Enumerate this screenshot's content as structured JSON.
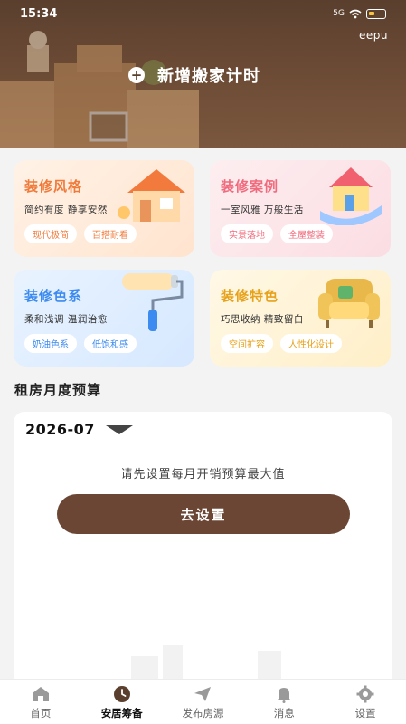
{
  "status_bar": {
    "time": "15:34",
    "network": "5G",
    "battery": "11"
  },
  "header": {
    "brand": "eepu",
    "add_timer_label": "新增搬家计时"
  },
  "cards": [
    {
      "title": "装修风格",
      "subtitle": "简约有度 静享安然",
      "tags": [
        "现代极简",
        "百搭耐看"
      ]
    },
    {
      "title": "装修案例",
      "subtitle": "一室风雅 万般生活",
      "tags": [
        "实景落地",
        "全屋整装"
      ]
    },
    {
      "title": "装修色系",
      "subtitle": "柔和浅调 温润治愈",
      "tags": [
        "奶油色系",
        "低饱和感"
      ]
    },
    {
      "title": "装修特色",
      "subtitle": "巧思收纳 精致留白",
      "tags": [
        "空间扩容",
        "人性化设计"
      ]
    }
  ],
  "budget": {
    "section_title": "租房月度预算",
    "month": "2026-07",
    "hint": "请先设置每月开销预算最大值",
    "button_label": "去设置"
  },
  "tabbar": {
    "items": [
      {
        "label": "首页",
        "icon": "home-icon"
      },
      {
        "label": "安居筹备",
        "icon": "clock-icon"
      },
      {
        "label": "发布房源",
        "icon": "send-icon"
      },
      {
        "label": "消息",
        "icon": "bell-icon"
      },
      {
        "label": "设置",
        "icon": "gear-icon"
      }
    ]
  },
  "colors": {
    "brand_brown": "#6b4634",
    "header_brown": "#5a3f2e"
  }
}
